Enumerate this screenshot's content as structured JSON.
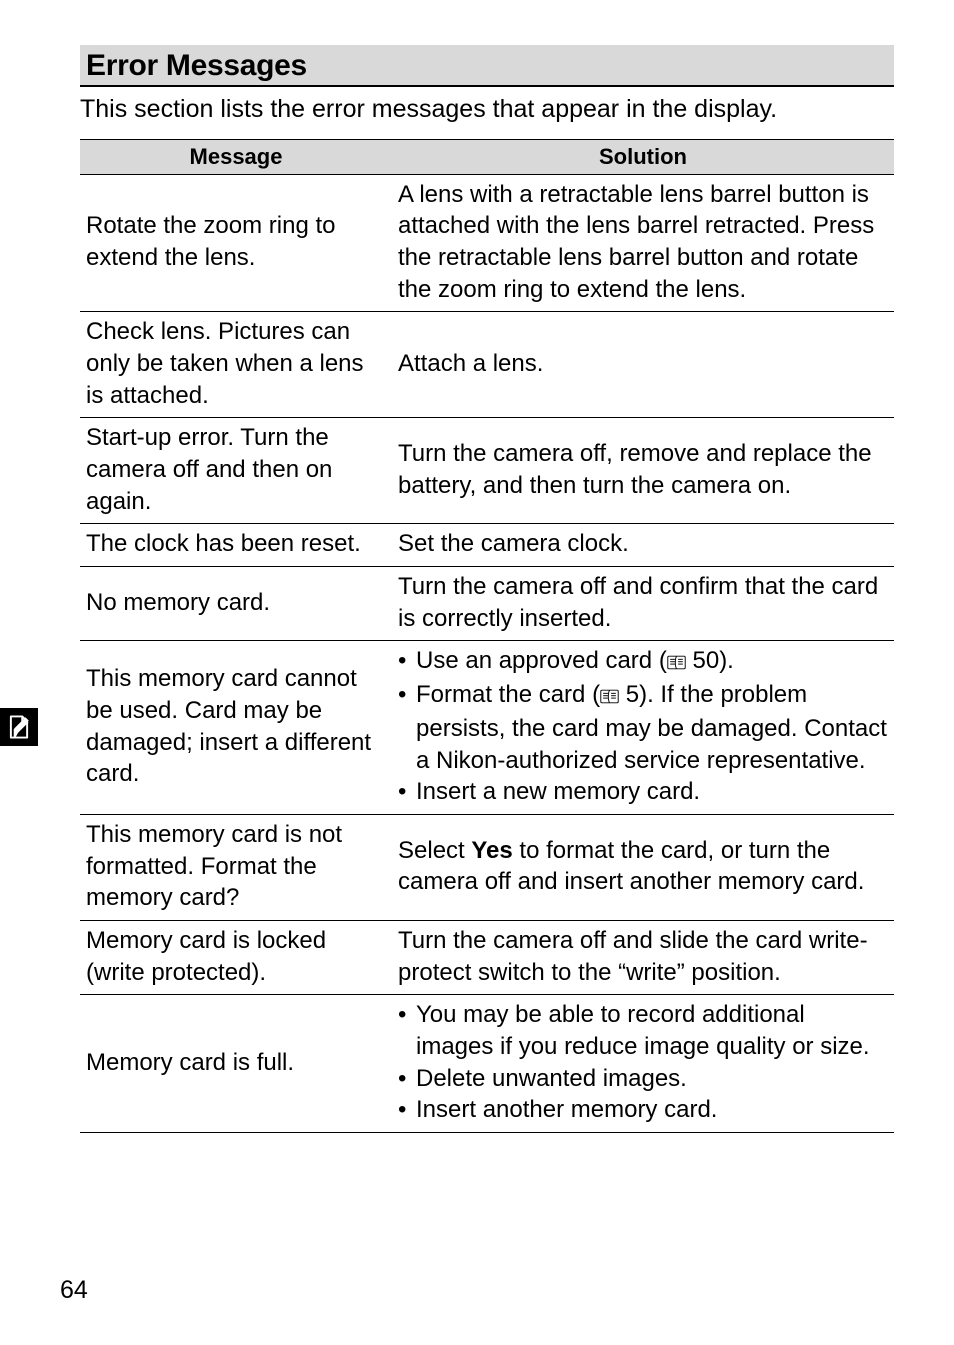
{
  "section": {
    "title": "Error Messages"
  },
  "intro": "This section lists the error messages that appear in the display.",
  "table": {
    "headers": {
      "message": "Message",
      "solution": "Solution"
    },
    "rows": [
      {
        "message": "Rotate the zoom ring to extend the lens.",
        "solution_plain": "A lens with a retractable lens barrel button is attached with the lens barrel retracted. Press the retractable lens barrel button and rotate the zoom ring to extend the lens.",
        "justify": true
      },
      {
        "message": "Check lens. Pictures can only be taken when a lens is attached.",
        "solution_plain": "Attach a lens."
      },
      {
        "message": "Start-up error. Turn the camera off and then on again.",
        "solution_plain": "Turn the camera off, remove and replace the battery, and then turn the camera on.",
        "justify": true
      },
      {
        "message": "The clock has been reset.",
        "solution_plain": "Set the camera clock."
      },
      {
        "message": "No memory card.",
        "solution_plain": "Turn the camera off and confirm that the card is correctly inserted.",
        "justify": true
      },
      {
        "message": "This memory card cannot be used. Card may be damaged; insert a different card.",
        "solution_bullets": [
          {
            "pre": "Use an approved card (",
            "ref": "50",
            "post": ")."
          },
          {
            "pre": "Format the card (",
            "ref": "5",
            "post": "). If the problem persists, the card may be damaged. Contact a Nikon-authorized service representative.",
            "justify": true
          },
          {
            "text": "Insert a new memory card."
          }
        ]
      },
      {
        "message": "This memory card is not formatted. Format the",
        "message_line2": "memory card?",
        "solution_rich": {
          "pre": "Select ",
          "bold": "Yes",
          "post": " to format the card, or turn the camera off and insert another memory card."
        },
        "justify": true
      },
      {
        "message": "Memory card is locked (write protected).",
        "solution_plain": "Turn the camera off and slide the card write-protect switch to the “write” position.",
        "justify": true
      },
      {
        "message": "Memory card is full.",
        "solution_bullets": [
          {
            "text": "You may be able to record additional images if you reduce image quality or size.",
            "justify": true
          },
          {
            "text": "Delete unwanted images."
          },
          {
            "text": "Insert another memory card."
          }
        ]
      }
    ]
  },
  "page_number": "64",
  "icons": {
    "side_tab": "note-pencil-icon"
  }
}
